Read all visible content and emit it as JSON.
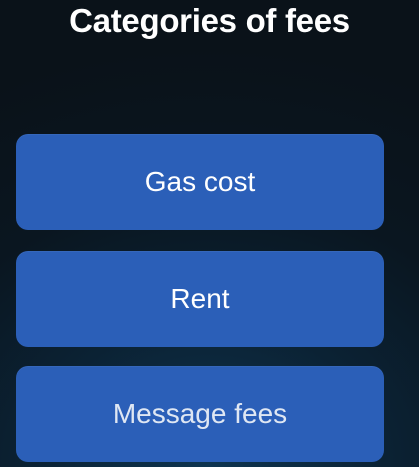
{
  "page": {
    "title": "Categories of fees"
  },
  "options": [
    {
      "label": "Gas cost"
    },
    {
      "label": "Rent"
    },
    {
      "label": "Message fees"
    }
  ],
  "colors": {
    "button": "#2b5fb8",
    "background": "#0b2234",
    "text": "#ffffff"
  }
}
